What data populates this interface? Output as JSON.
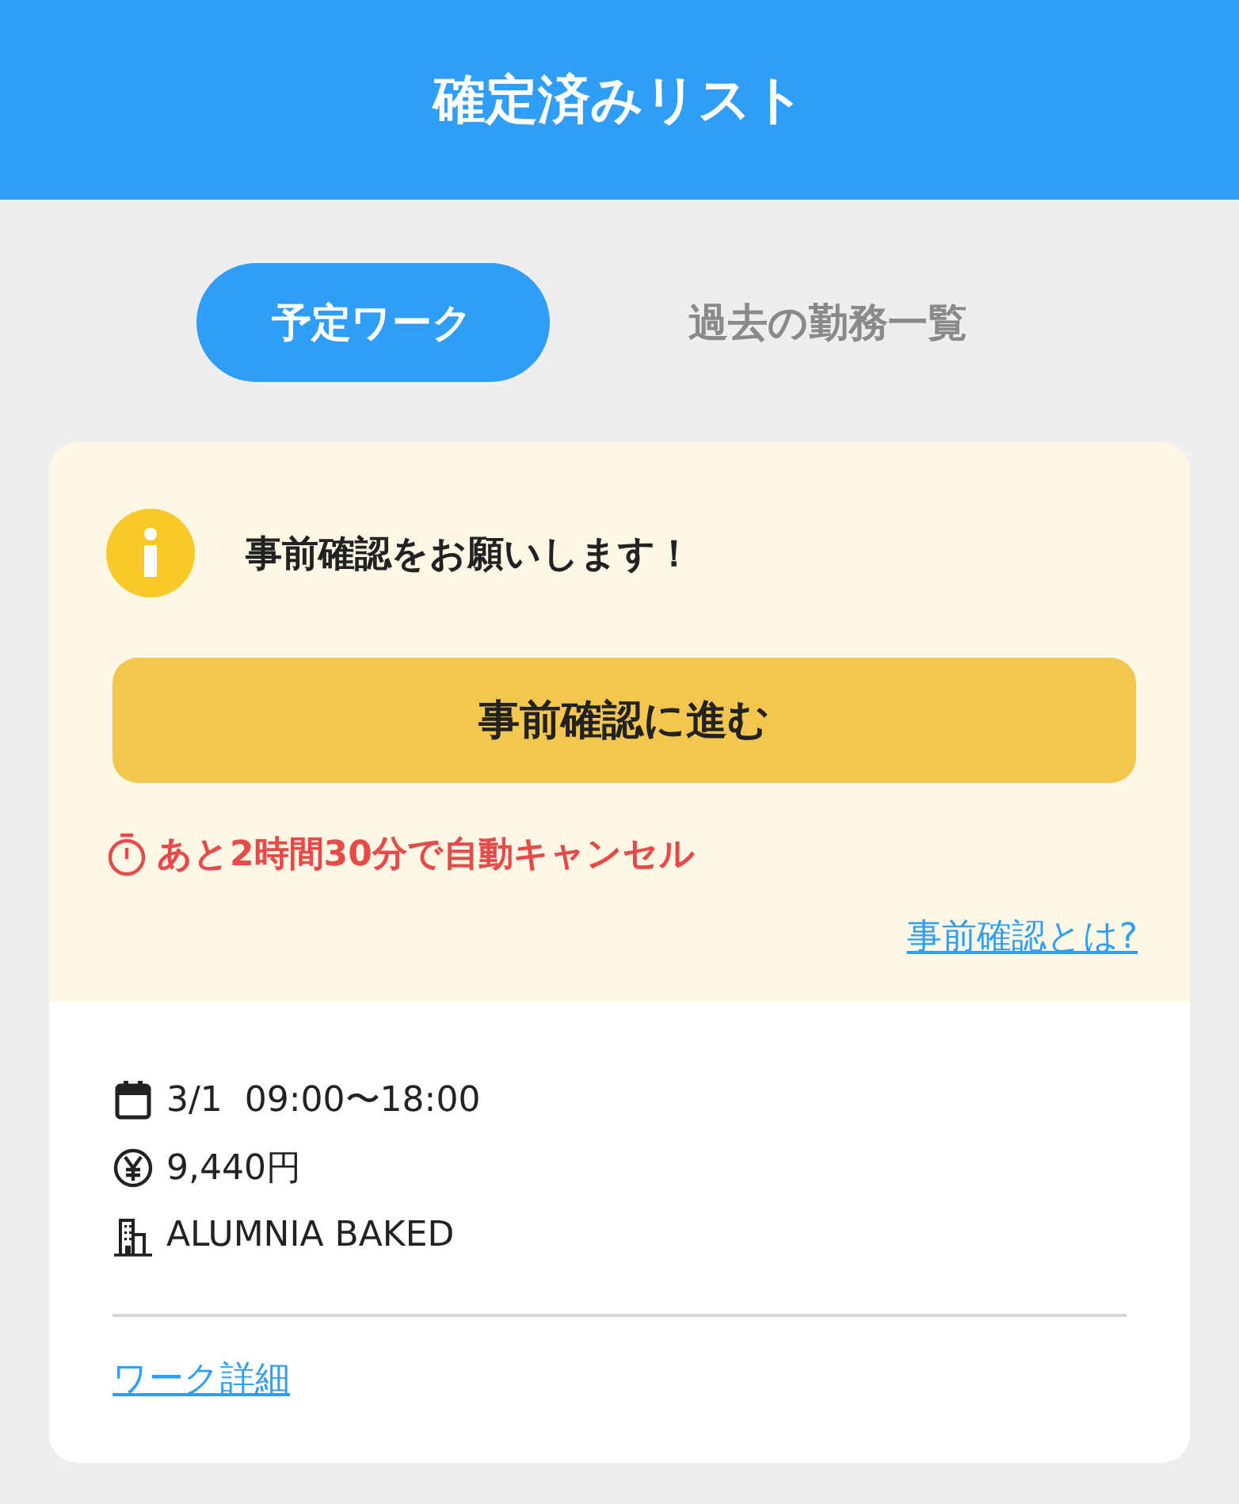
{
  "header": {
    "title": "確定済みリスト"
  },
  "tabs": [
    {
      "label": "予定ワーク",
      "selected": true
    },
    {
      "label": "過去の勤務一覧",
      "selected": false
    }
  ],
  "notice": {
    "message": "事前確認をお願いします！",
    "button": "事前確認に進む",
    "warning": "あと2時間30分で自動キャンセル",
    "help_link": "事前確認とは?"
  },
  "details": [
    {
      "kind": "calendar",
      "text": "3/1  09:00〜18:00"
    },
    {
      "kind": "yen",
      "text": "9,440円"
    },
    {
      "kind": "building",
      "text": "ALUMNIA BAKED"
    }
  ],
  "detail_link": "ワーク詳細"
}
